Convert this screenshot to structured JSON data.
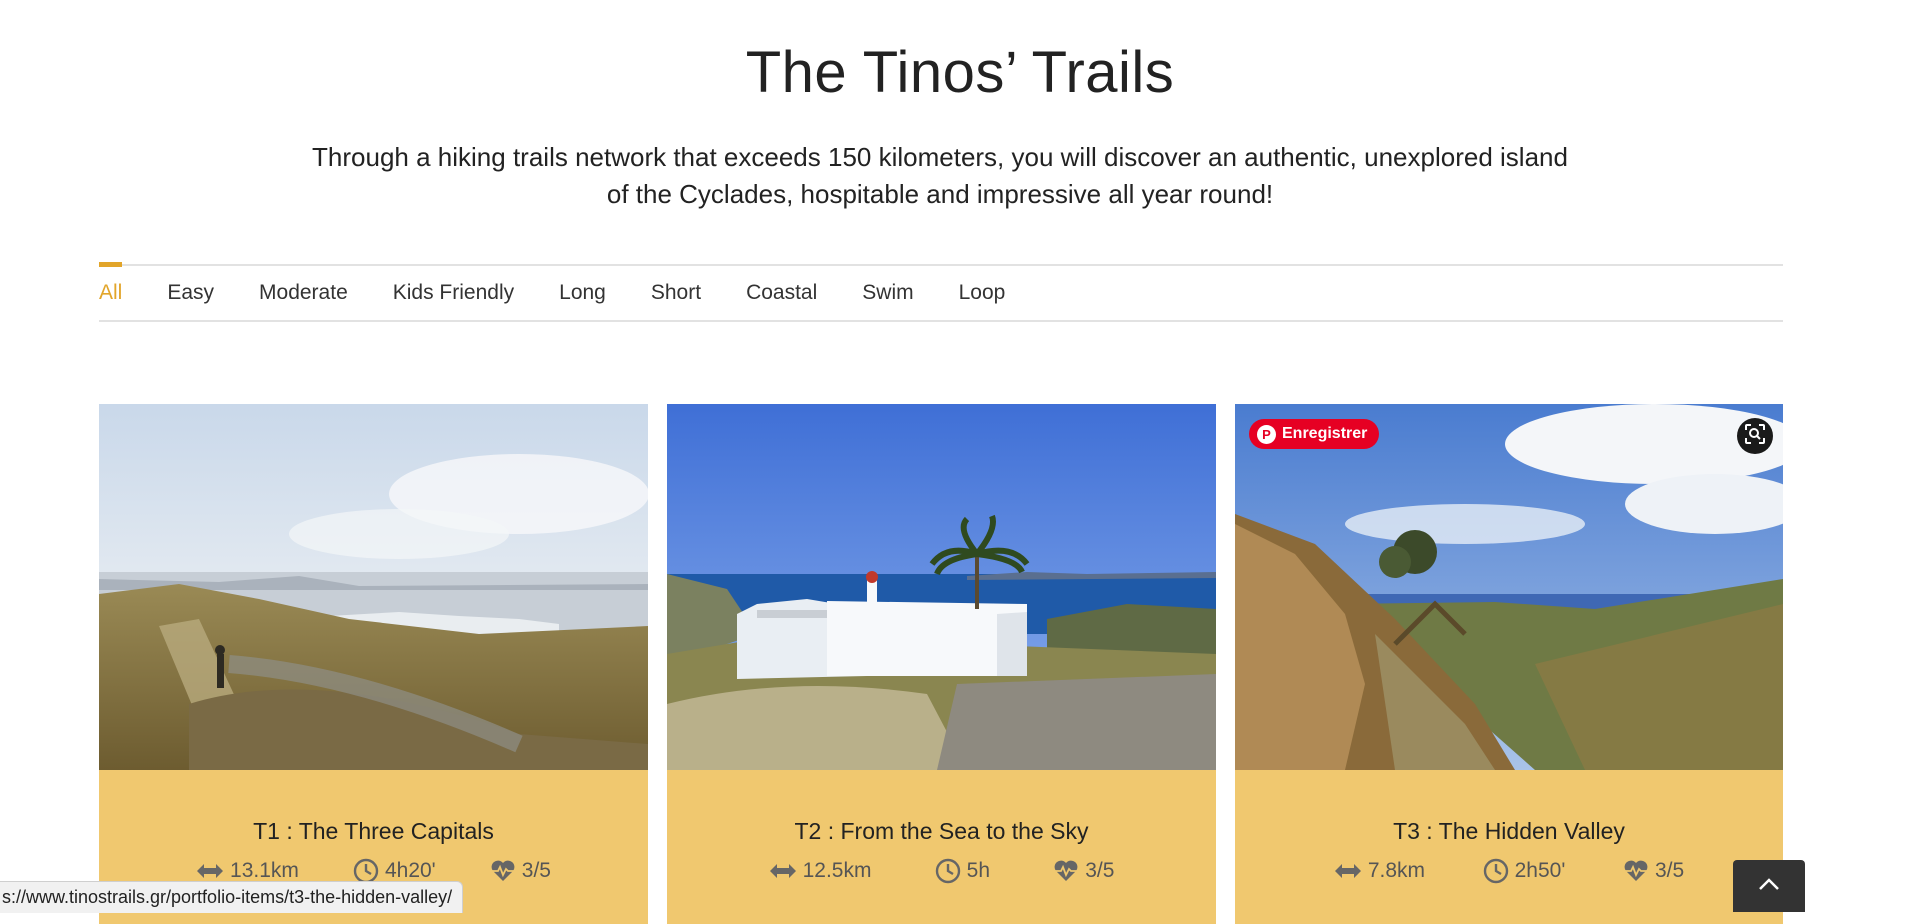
{
  "page": {
    "title": "The Tinos’ Trails",
    "intro": "Through a hiking trails network that exceeds 150 kilometers, you will discover an authentic, unexplored island of the Cyclades, hospitable and impressive all year round!"
  },
  "filters": [
    {
      "label": "All",
      "active": true
    },
    {
      "label": "Easy",
      "active": false
    },
    {
      "label": "Moderate",
      "active": false
    },
    {
      "label": "Kids Friendly",
      "active": false
    },
    {
      "label": "Long",
      "active": false
    },
    {
      "label": "Short",
      "active": false
    },
    {
      "label": "Coastal",
      "active": false
    },
    {
      "label": "Swim",
      "active": false
    },
    {
      "label": "Loop",
      "active": false
    }
  ],
  "trails": [
    {
      "title": "T1 : The Three Capitals",
      "distance": "13.1km",
      "duration": "4h20'",
      "difficulty": "3/5"
    },
    {
      "title": "T2 : From the Sea to the Sky",
      "distance": "12.5km",
      "duration": "5h",
      "difficulty": "3/5"
    },
    {
      "title": "T3 : The Hidden Valley",
      "distance": "7.8km",
      "duration": "2h50'",
      "difficulty": "3/5"
    }
  ],
  "overlay": {
    "pin_label": "Enregistrer",
    "pin_icon": "pinterest-icon",
    "lens_icon": "visual-search-icon"
  },
  "status_bar": {
    "url": "s://www.tinostrails.gr/portfolio-items/t3-the-hidden-valley/"
  },
  "icons": {
    "distance": "arrows-horizontal-icon",
    "duration": "clock-icon",
    "difficulty": "heartbeat-icon",
    "back_to_top": "chevron-up-icon"
  },
  "colors": {
    "accent": "#e2a52a",
    "card_background": "#f0c86f",
    "pinterest": "#e60023"
  }
}
